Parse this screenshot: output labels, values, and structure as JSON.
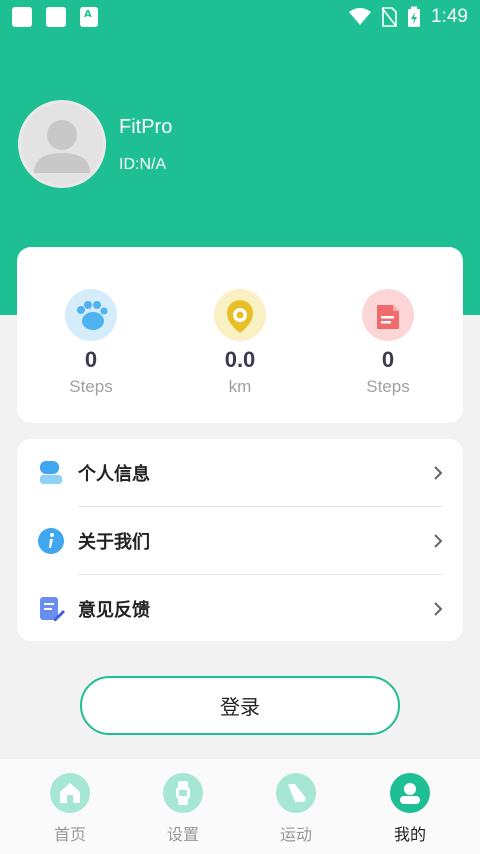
{
  "status_bar": {
    "time": "1:49"
  },
  "profile": {
    "name": "FitPro",
    "id_text": "ID:N/A"
  },
  "stats": [
    {
      "value": "0",
      "unit": "Steps",
      "icon": "footprint-icon",
      "color": "#4fb3f0"
    },
    {
      "value": "0.0",
      "unit": "km",
      "icon": "location-icon",
      "color": "#e7c028"
    },
    {
      "value": "0",
      "unit": "Steps",
      "icon": "document-icon",
      "color": "#f06b6b"
    }
  ],
  "menu": [
    {
      "label": "个人信息",
      "icon": "person-icon"
    },
    {
      "label": "关于我们",
      "icon": "info-icon"
    },
    {
      "label": "意见反馈",
      "icon": "feedback-icon"
    }
  ],
  "login_label": "登录",
  "nav": [
    {
      "label": "首页",
      "icon": "home-icon",
      "active": false
    },
    {
      "label": "设置",
      "icon": "watch-icon",
      "active": false
    },
    {
      "label": "运动",
      "icon": "shoe-icon",
      "active": false
    },
    {
      "label": "我的",
      "icon": "profile-icon",
      "active": true
    }
  ],
  "colors": {
    "accent": "#1fbf94",
    "background": "#f2f2f2"
  }
}
